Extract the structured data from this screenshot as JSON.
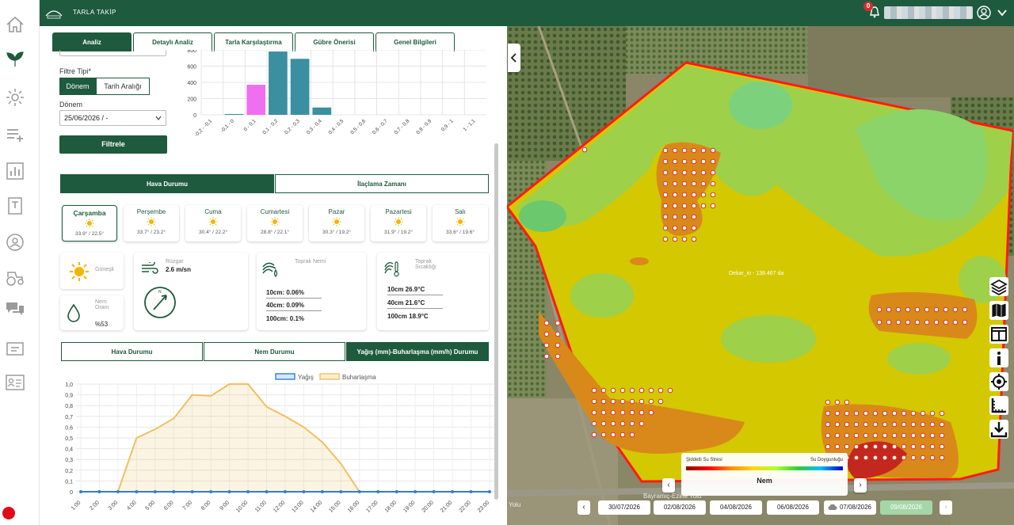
{
  "app": {
    "title": "TARLA TAKİP",
    "notification_count": "0"
  },
  "sidebar": {
    "items": [
      "home-icon",
      "leaf-icon",
      "sun-settings-icon",
      "list-add-icon",
      "bar-chart-icon",
      "document-icon",
      "globe-user-icon",
      "tractor-icon",
      "chat-icon",
      "message-icon",
      "contact-card-icon"
    ]
  },
  "tabs": [
    {
      "label": "Analiz",
      "active": true
    },
    {
      "label": "Detaylı Analiz",
      "active": false
    },
    {
      "label": "Tarla Karşılaştırma",
      "active": false
    },
    {
      "label": "Gübre Önerisi",
      "active": false
    },
    {
      "label": "Genel Bilgileri",
      "active": false
    }
  ],
  "filter": {
    "type_label": "Filtre Tipi*",
    "seg_period": "Dönem",
    "seg_range": "Tarih Aralığı",
    "period_label": "Dönem",
    "period_value": "25/06/2026 / -",
    "button": "Filtrele"
  },
  "chart_data": [
    {
      "type": "bar",
      "categories": [
        "-0,2 - -0,1",
        "-0,1 - 0",
        "0 - 0,1",
        "0,1 - 0,2",
        "0,2 - 0,3",
        "0,3 - 0,4",
        "0,4 - 0,5",
        "0,5 - 0,6",
        "0,6 - 0,7",
        "0,7 - 0,8",
        "0,8 - 0,9",
        "0,9 - 1",
        "1 - 1,1"
      ],
      "values": [
        0,
        10,
        370,
        780,
        690,
        90,
        0,
        0,
        0,
        0,
        0,
        0,
        0
      ],
      "colors": [
        "#3a8fa0",
        "#3a8fa0",
        "#f06ef0",
        "#3a8fa0",
        "#3a8fa0",
        "#3a8fa0",
        "#3a8fa0",
        "#3a8fa0",
        "#3a8fa0",
        "#3a8fa0",
        "#3a8fa0",
        "#3a8fa0",
        "#3a8fa0"
      ],
      "yticks": [
        0,
        200,
        400,
        600,
        800
      ],
      "ylim": [
        0,
        800
      ]
    },
    {
      "type": "area",
      "title": "",
      "legend": [
        "Yağış",
        "Buharlaşma"
      ],
      "legend_position": "top-center",
      "x": [
        "1:00",
        "2:00",
        "3:00",
        "4:00",
        "5:00",
        "6:00",
        "7:00",
        "8:00",
        "9:00",
        "10:00",
        "11:00",
        "12:00",
        "13:00",
        "14:00",
        "15:00",
        "16:00",
        "17:00",
        "18:00",
        "19:00",
        "20:00",
        "21:00",
        "22:00",
        "23:00"
      ],
      "series": [
        {
          "name": "Yağış",
          "color": "#2f7ed8",
          "values": [
            0,
            0,
            0,
            0,
            0,
            0,
            0,
            0,
            0,
            0,
            0,
            0,
            0,
            0,
            0,
            0,
            0,
            0,
            0,
            0,
            0,
            0,
            0
          ]
        },
        {
          "name": "Buharlaşma",
          "color": "#f0c060",
          "values": [
            0,
            0,
            0,
            0.5,
            0.58,
            0.68,
            0.9,
            0.89,
            1.0,
            1.0,
            0.79,
            0.7,
            0.6,
            0.46,
            0.26,
            0,
            0,
            0,
            0,
            0,
            0,
            0,
            0
          ]
        }
      ],
      "yticks": [
        "0",
        "0,1",
        "0,2",
        "0,3",
        "0,4",
        "0,5",
        "0,6",
        "0,7",
        "0,8",
        "0,9",
        "1,0"
      ],
      "ylim": [
        0,
        1
      ],
      "grid": true
    }
  ],
  "weather_tabs": {
    "left": "Hava Durumu",
    "right": "İlaçlama Zamanı"
  },
  "days": [
    {
      "name": "Çarşamba",
      "temps": "33.9° / 22.5°",
      "selected": true
    },
    {
      "name": "Perşembe",
      "temps": "33.7° / 23.2°",
      "selected": false
    },
    {
      "name": "Cuma",
      "temps": "30.4° / 22.2°",
      "selected": false
    },
    {
      "name": "Cumartesi",
      "temps": "28.8° / 22.1°",
      "selected": false
    },
    {
      "name": "Pazar",
      "temps": "30.3° / 19.2°",
      "selected": false
    },
    {
      "name": "Pazartesi",
      "temps": "31.9° / 19.2°",
      "selected": false
    },
    {
      "name": "Salı",
      "temps": "33.6° / 19.6°",
      "selected": false
    }
  ],
  "conditions": {
    "sun": "Güneşli",
    "humidity_label": "Nem Oranı",
    "humidity_value": "%53",
    "wind_label": "Rüzgar",
    "wind_value": "2.6 m/sn",
    "soil_moist_label": "Toprak Nemi",
    "soil_moist": [
      "10cm: 0.06%",
      "40cm: 0.09%",
      "100cm: 0.1%"
    ],
    "soil_temp_label": "Toprak Sıcaklığı",
    "soil_temp": [
      "10cm 26.9°C",
      "40cm 21.6°C",
      "100cm 18.9°C"
    ]
  },
  "chart_tabs": [
    "Hava Durumu",
    "Nem Durumu",
    "Yağış (mm)-Buharlaşma (mm/h) Durumu"
  ],
  "map": {
    "field_label": "Dekar_io - 138.467 da",
    "legend_left": "Şiddetli Su Stresi",
    "legend_right": "Su Doygunluğu",
    "legend_name": "Nem",
    "road": "Bayramiç-Ezine Yolu",
    "road2": "Yolu",
    "dates": [
      "30/07/2026",
      "02/08/2026",
      "04/08/2026",
      "06/08/2026",
      "07/08/2026",
      "09/08/2026"
    ],
    "active_date": "09/08/2026",
    "tools": [
      "layers-icon",
      "map-icon",
      "split-view-icon",
      "info-icon",
      "locate-icon",
      "ruler-icon",
      "download-icon"
    ]
  }
}
